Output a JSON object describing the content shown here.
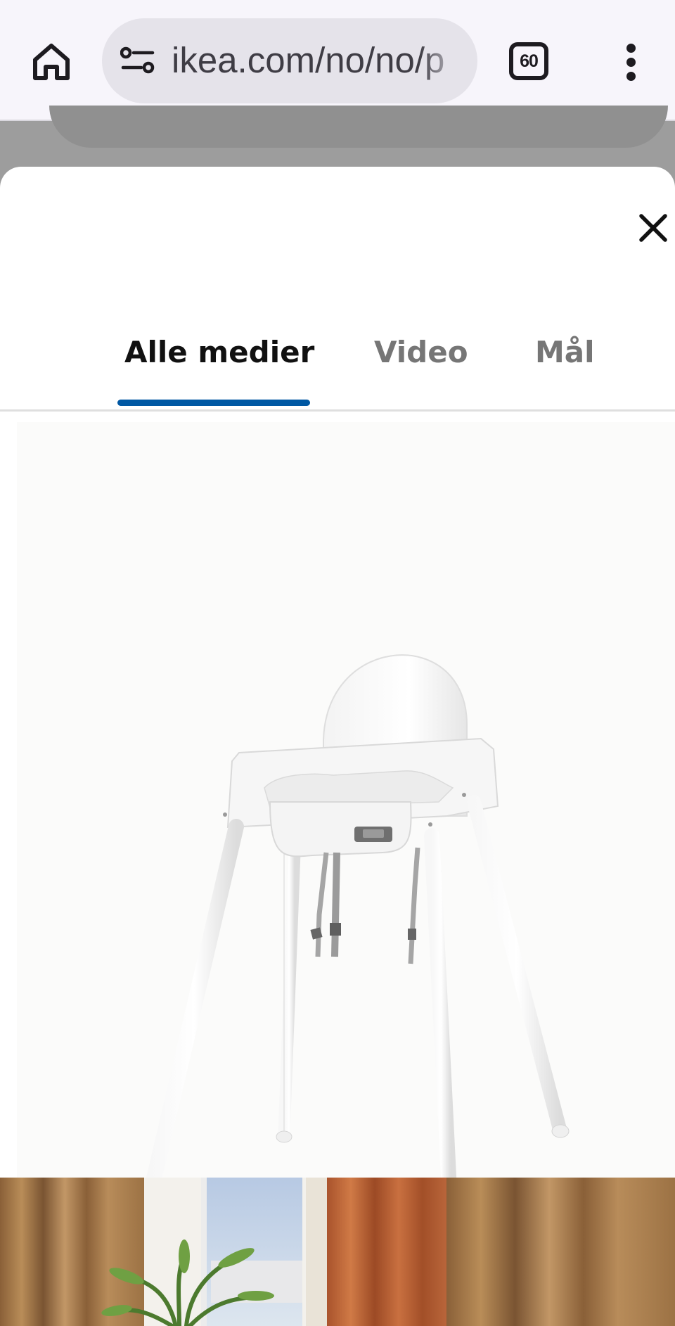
{
  "browser": {
    "url": "ikea.com/no/no/p",
    "tab_count": "60",
    "icons": [
      "home-icon",
      "site-settings-icon",
      "tab-switcher-icon",
      "more-vert-icon"
    ]
  },
  "modal": {
    "close_icon": "close-icon",
    "tabs": [
      {
        "label": "Alle medier",
        "active": true
      },
      {
        "label": "Video",
        "active": false
      },
      {
        "label": "Mål",
        "active": false
      }
    ],
    "images": [
      "white-high-chair-photo",
      "room-window-curtains-photo"
    ]
  },
  "colors": {
    "accent": "#0058a3",
    "active_tab_text": "#111111",
    "inactive_tab_text": "#767676",
    "browser_bar": "#f7f5fb",
    "url_pill": "#e5e3ea"
  }
}
